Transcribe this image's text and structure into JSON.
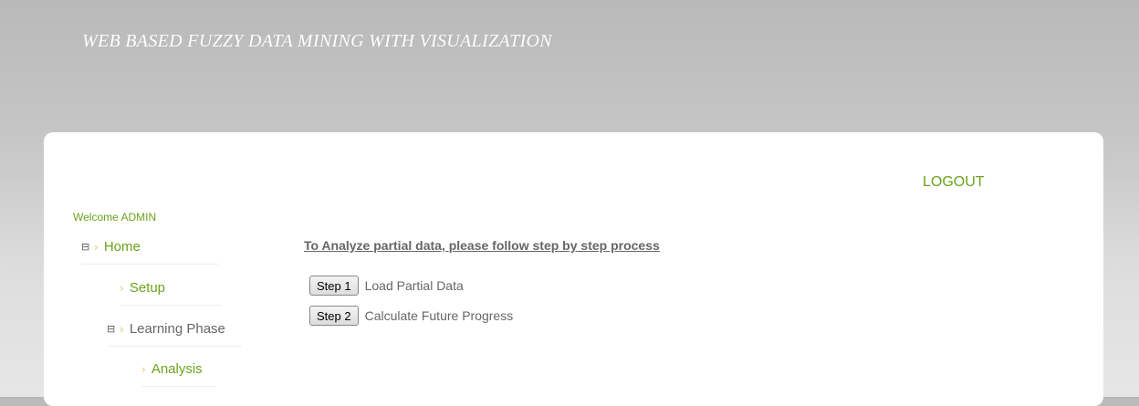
{
  "header": {
    "title": "WEB BASED FUZZY DATA MINING WITH VISUALIZATION"
  },
  "top_links": {
    "logout": "LOGOUT"
  },
  "sidebar": {
    "welcome": "Welcome ADMIN",
    "items": [
      {
        "label": "Home",
        "toggle": "⊟",
        "chevron": "›"
      },
      {
        "label": "Setup",
        "toggle": "",
        "chevron": "›"
      },
      {
        "label": "Learning Phase",
        "toggle": "⊟",
        "chevron": "›"
      },
      {
        "label": "Analysis",
        "toggle": "",
        "chevron": "›"
      }
    ]
  },
  "main": {
    "instruction": "To Analyze partial data, please follow step by step process",
    "steps": [
      {
        "button": "Step 1",
        "description": "Load Partial Data"
      },
      {
        "button": "Step 2",
        "description": "Calculate Future Progress"
      }
    ]
  },
  "colors": {
    "accent": "#6aa31b",
    "chevron": "#e5c25c",
    "text": "#666666"
  }
}
